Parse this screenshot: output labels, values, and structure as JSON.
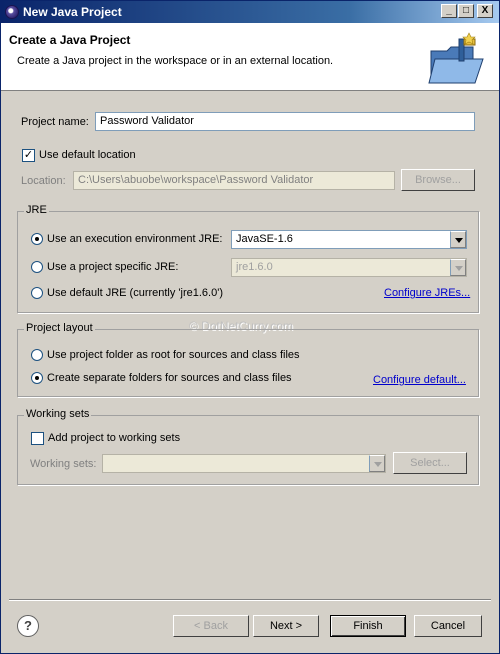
{
  "window": {
    "title": "New Java Project",
    "controls": {
      "minimize": "_",
      "maximize": "□",
      "close": "X"
    }
  },
  "header": {
    "title": "Create a Java Project",
    "description": "Create a Java project in the workspace or in an external location.",
    "icon": "new-java-project-folder-icon"
  },
  "project": {
    "name_label": "Project name:",
    "name_value": "Password Validator"
  },
  "location": {
    "use_default_label": "Use default location",
    "use_default_checked": true,
    "label": "Location:",
    "value": "C:\\Users\\abuobe\\workspace\\Password Validator",
    "browse_label": "Browse..."
  },
  "jre": {
    "group_title": "JRE",
    "option_env": "Use an execution environment JRE:",
    "env_value": "JavaSE-1.6",
    "option_specific": "Use a project specific JRE:",
    "specific_value": "jre1.6.0",
    "option_default": "Use default JRE (currently 'jre1.6.0')",
    "configure_link": "Configure JREs...",
    "selected": "env"
  },
  "layout": {
    "group_title": "Project layout",
    "option_root": "Use project folder as root for sources and class files",
    "option_separate": "Create separate folders for sources and class files",
    "configure_link": "Configure default...",
    "selected": "separate"
  },
  "working_sets": {
    "group_title": "Working sets",
    "add_label": "Add project to working sets",
    "add_checked": false,
    "label": "Working sets:",
    "value": "",
    "select_label": "Select..."
  },
  "watermark": "© DotNetCurry.com",
  "footer": {
    "help_glyph": "?",
    "back_label": "< Back",
    "next_label": "Next >",
    "finish_label": "Finish",
    "cancel_label": "Cancel"
  },
  "colors": {
    "dialog_bg": "#d4d0c8",
    "title_bar": "#0a246a",
    "link": "#0000cc"
  }
}
